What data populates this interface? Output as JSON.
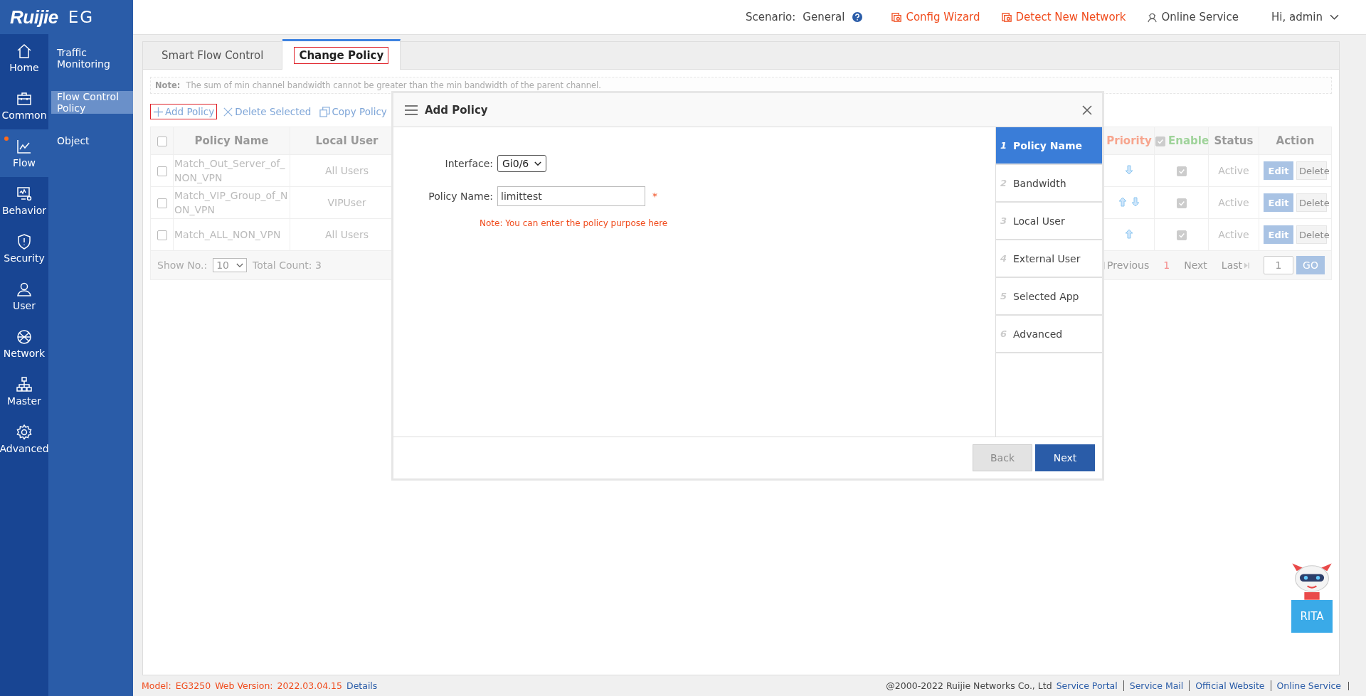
{
  "brand": {
    "logo": "Ruijie",
    "product": "EG"
  },
  "header": {
    "scenario_label": "Scenario:",
    "scenario_value": "General",
    "links": [
      {
        "label": "Config Wizard",
        "kind": "wizard"
      },
      {
        "label": "Detect New Network",
        "kind": "wizard"
      },
      {
        "label": "Online Service",
        "kind": "service"
      }
    ],
    "user": "Hi, admin"
  },
  "nav": [
    {
      "label": "Home",
      "selected": false,
      "alert": false
    },
    {
      "label": "Common",
      "selected": false,
      "alert": false
    },
    {
      "label": "Flow",
      "selected": true,
      "alert": true
    },
    {
      "label": "Behavior",
      "selected": false,
      "alert": false
    },
    {
      "label": "Security",
      "selected": false,
      "alert": false
    },
    {
      "label": "User",
      "selected": false,
      "alert": false
    },
    {
      "label": "Network",
      "selected": false,
      "alert": false
    },
    {
      "label": "Master",
      "selected": false,
      "alert": false
    },
    {
      "label": "Advanced",
      "selected": false,
      "alert": false
    }
  ],
  "submenu": [
    {
      "label": "Traffic Monitoring",
      "selected": false
    },
    {
      "label": "Flow Control Policy",
      "selected": true
    },
    {
      "label": "Object",
      "selected": false
    }
  ],
  "tabs": [
    {
      "label": "Smart Flow Control",
      "selected": false,
      "outlined": false
    },
    {
      "label": "Change Policy",
      "selected": true,
      "outlined": true
    }
  ],
  "note": {
    "label": "Note:",
    "text": "The sum of min channel bandwidth cannot be greater than the min bandwidth of the parent channel."
  },
  "toolbar": [
    {
      "label": "Add Policy",
      "outlined": true
    },
    {
      "label": "Delete Selected",
      "outlined": false
    },
    {
      "label": "Copy Policy",
      "outlined": false
    }
  ],
  "table": {
    "columns": [
      "Policy Name",
      "Local User",
      "Priority",
      "Enable",
      "Status",
      "Action"
    ],
    "all_checked": false,
    "enable_all_checked": true,
    "rows": [
      {
        "checked": false,
        "name": "Match_Out_Server_of_NON_VPN",
        "local_user": "All Users",
        "up": false,
        "down": true,
        "enabled": true,
        "status": "Active",
        "actions": [
          "Edit",
          "Delete"
        ]
      },
      {
        "checked": false,
        "name": "Match_VIP_Group_of_NON_VPN",
        "local_user": "VIPUser",
        "up": true,
        "down": true,
        "enabled": true,
        "status": "Active",
        "actions": [
          "Edit",
          "Delete"
        ]
      },
      {
        "checked": false,
        "name": "Match_ALL_NON_VPN",
        "local_user": "All Users",
        "up": true,
        "down": false,
        "enabled": true,
        "status": "Active",
        "actions": [
          "Edit",
          "Delete"
        ]
      }
    ],
    "pager": {
      "show_label": "Show No.:",
      "page_size": "10",
      "total": "Total Count: 3",
      "previous": "Previous",
      "page": "1",
      "next": "Next",
      "last": "Last",
      "goto": "1",
      "go": "GO"
    }
  },
  "modal": {
    "title": "Add Policy",
    "fields": [
      {
        "kind": "select",
        "label": "Interface:",
        "value": "Gi0/6"
      },
      {
        "kind": "text",
        "label": "Policy Name:",
        "value": "limittest",
        "required_mark": "*"
      }
    ],
    "hint": "Note: You can enter the policy purpose here",
    "steps": [
      {
        "number": "1",
        "label": "Policy Name",
        "selected": true
      },
      {
        "number": "2",
        "label": "Bandwidth",
        "selected": false
      },
      {
        "number": "3",
        "label": "Local User",
        "selected": false
      },
      {
        "number": "4",
        "label": "External User",
        "selected": false
      },
      {
        "number": "5",
        "label": "Selected App",
        "selected": false
      },
      {
        "number": "6",
        "label": "Advanced",
        "selected": false
      }
    ],
    "buttons": [
      {
        "label": "Back",
        "kind": "secondary"
      },
      {
        "label": "Next",
        "kind": "primary"
      }
    ]
  },
  "assistant": {
    "label": "RITA"
  },
  "footer": {
    "model_label": "Model:",
    "model": "EG3250",
    "version_label": "Web Version:",
    "version": "2022.03.04.15",
    "details": "Details",
    "copyright": "@2000-2022 Ruijie Networks Co., Ltd",
    "links": [
      "Service Portal",
      "Service Mail",
      "Official Website",
      "Online Service"
    ]
  }
}
